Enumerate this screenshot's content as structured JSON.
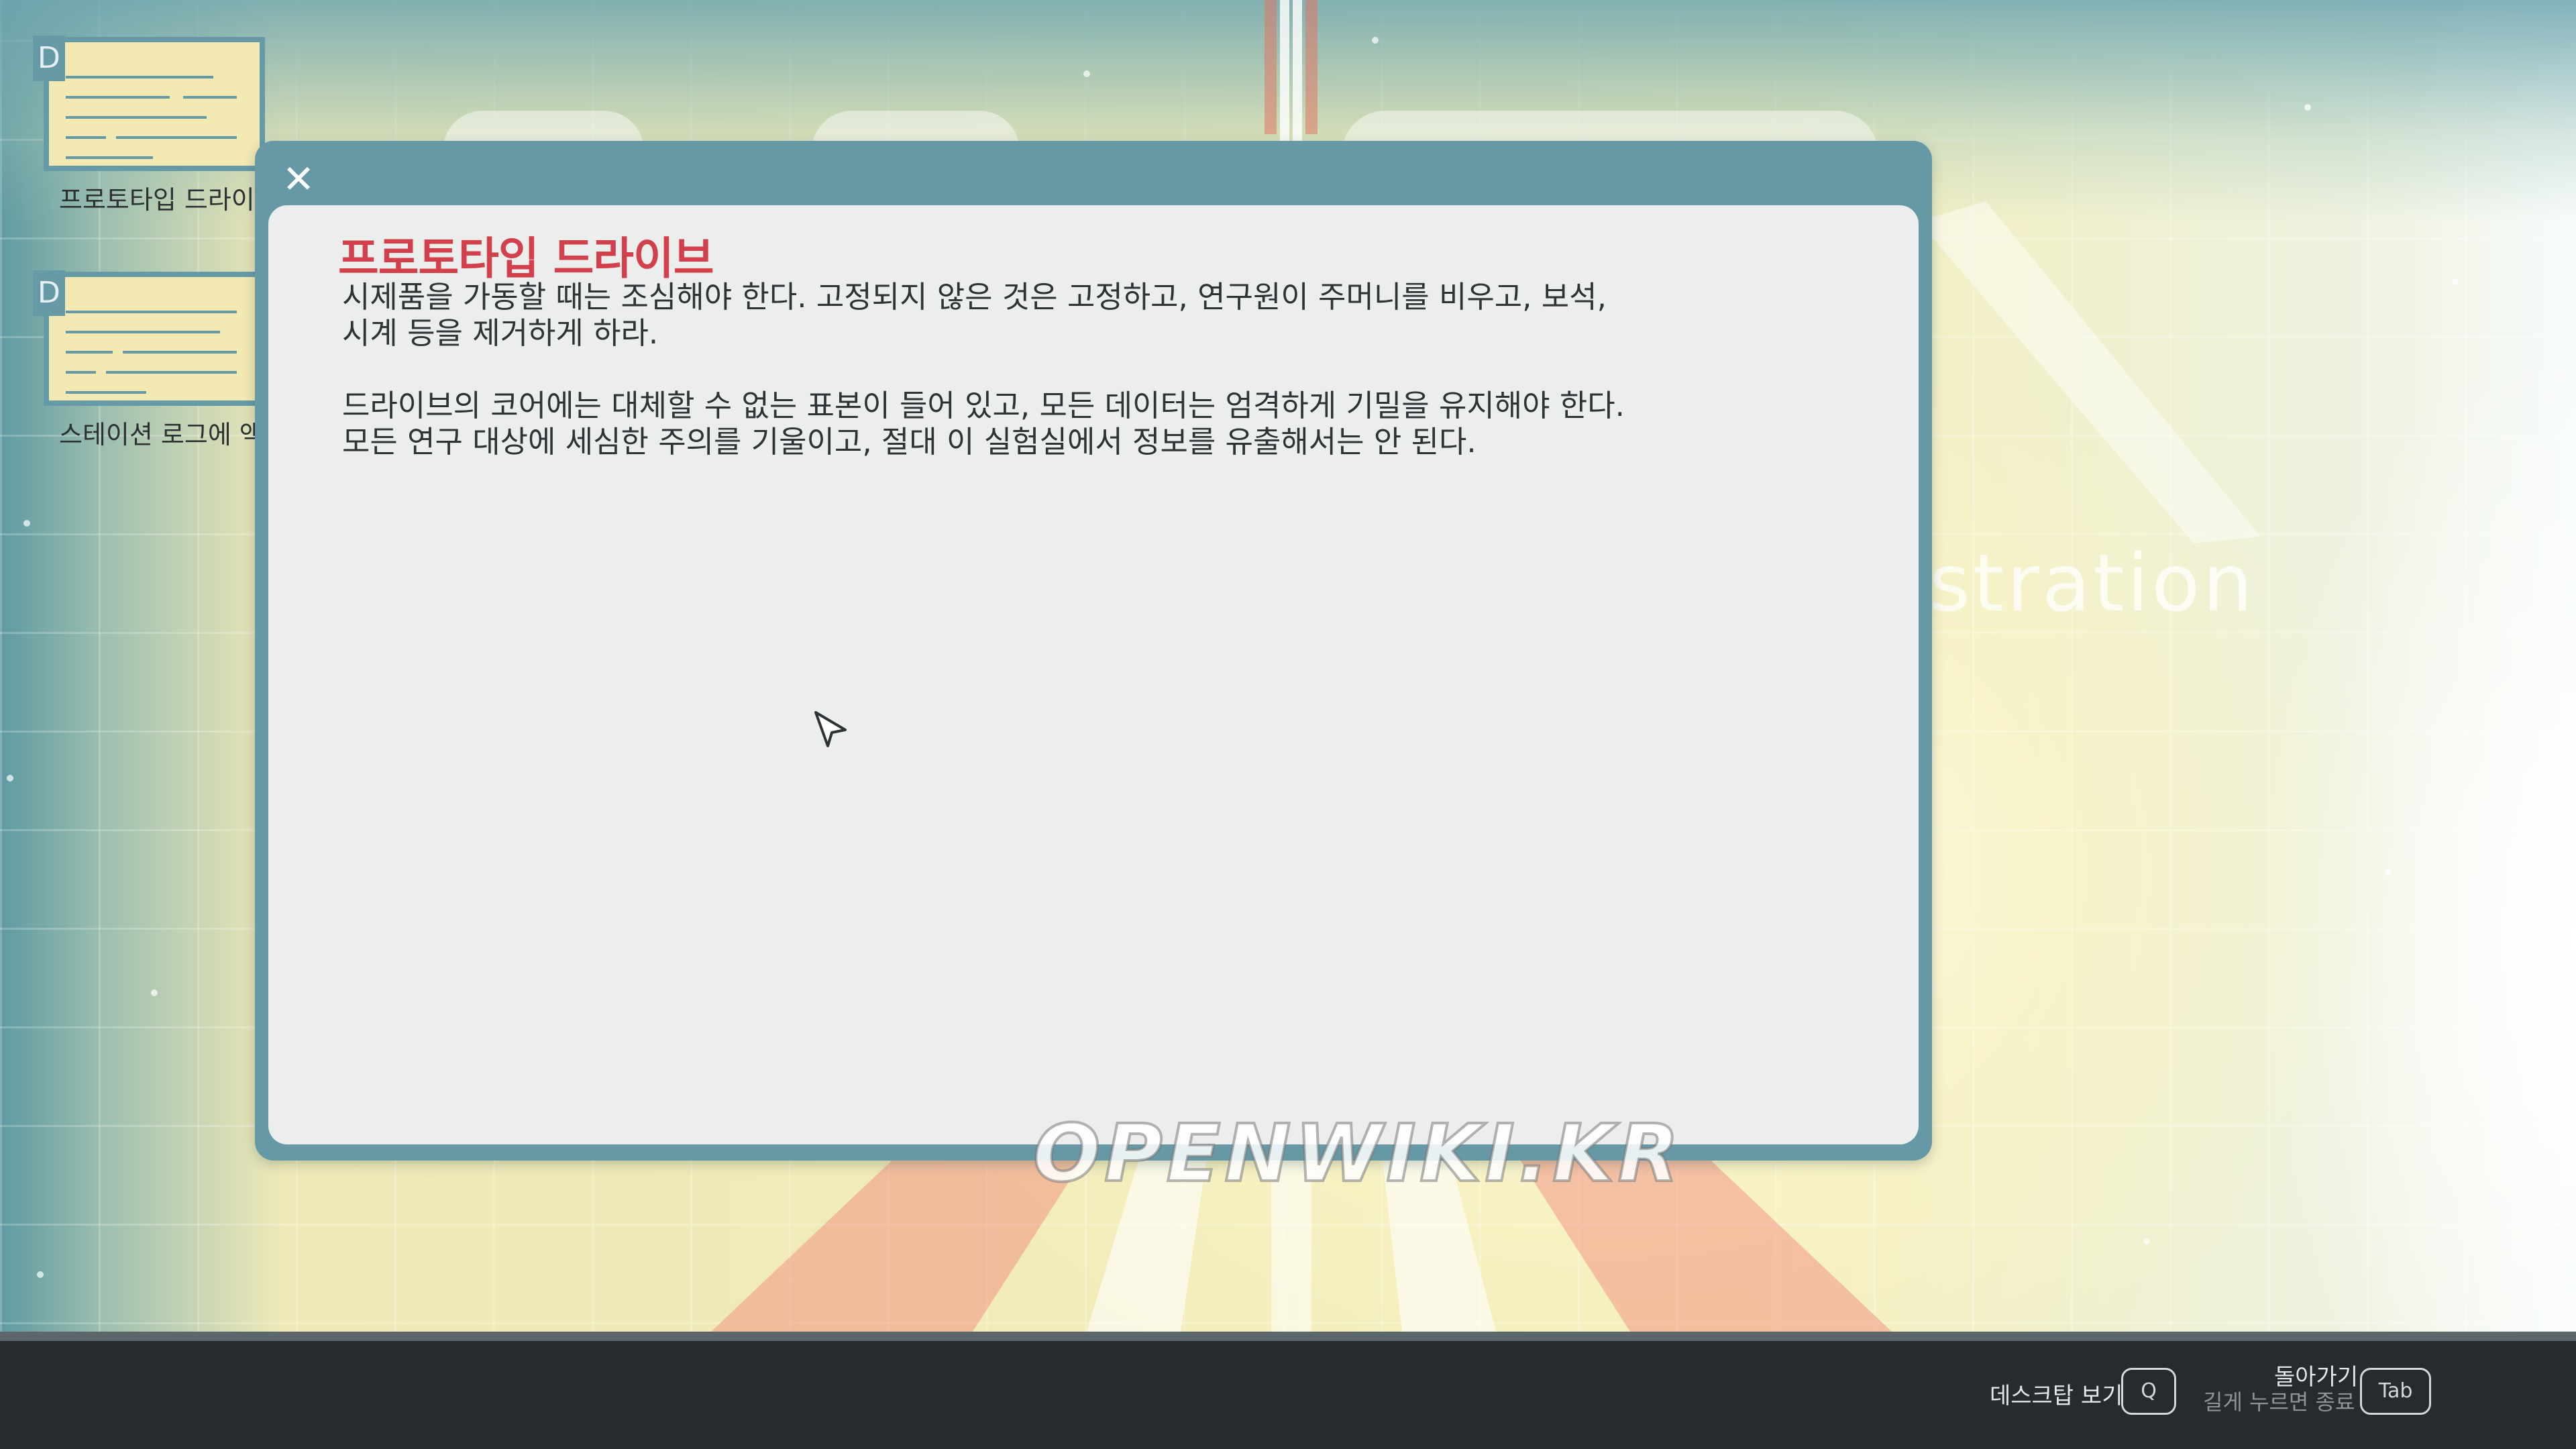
{
  "desktop": {
    "background_text": "nistration",
    "icons": [
      {
        "badge": "D",
        "label": "프로토타입 드라이브"
      },
      {
        "badge": "D",
        "label": "스테이션 로그에 액세스"
      }
    ]
  },
  "document": {
    "close_symbol": "✕",
    "title": "프로토타입 드라이브",
    "paragraphs": [
      "시제품을 가동할 때는 조심해야 한다. 고정되지 않은 것은 고정하고, 연구원이 주머니를 비우고, 보석,",
      "시계 등을 제거하게 하라.",
      "드라이브의 코어에는 대체할 수 없는 표본이 들어 있고, 모든 데이터는 엄격하게 기밀을 유지해야 한다.",
      "모든 연구 대상에 세심한 주의를 기울이고, 절대 이 실험실에서 정보를 유출해서는 안 된다."
    ]
  },
  "watermark": "OPENWIKI.KR",
  "taskbar": {
    "desktop_view_label": "데스크탑 보기",
    "desktop_view_key": "Q",
    "back_label": "돌아가기",
    "back_sublabel": "길게 누르면 종료",
    "back_key": "Tab"
  },
  "colors": {
    "window_frame": "#6698a6",
    "document_bg": "#eceeee",
    "title": "#d2404b",
    "taskbar": "#252b2e"
  }
}
